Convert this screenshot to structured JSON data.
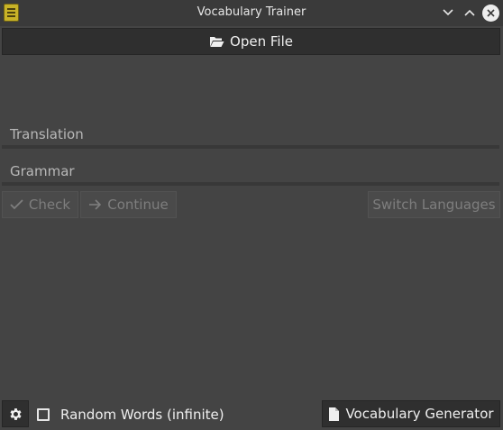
{
  "window": {
    "title": "Vocabulary Trainer",
    "icons": {
      "app": "vocabulary-app-icon",
      "minimize": "chevron-down-icon",
      "maximize": "chevron-up-icon",
      "close": "close-icon"
    }
  },
  "toolbar": {
    "open_file_label": "Open File",
    "open_file_icon": "folder-open-icon"
  },
  "fields": {
    "translation_placeholder": "Translation",
    "grammar_placeholder": "Grammar"
  },
  "actions": {
    "check_label": "Check",
    "check_icon": "checkmark-icon",
    "continue_label": "Continue",
    "continue_icon": "arrow-right-icon",
    "switch_languages_label": "Switch Languages",
    "enabled": false
  },
  "footer": {
    "settings_icon": "gear-icon",
    "random_words_label": "Random Words (infinite)",
    "random_words_checked": false,
    "vocab_generator_label": "Vocabulary Generator",
    "vocab_generator_icon": "document-icon"
  },
  "colors": {
    "background": "#444444",
    "titlebar": "#3a3a3a",
    "button": "#2f2f2f",
    "disabled_text": "#7e7e7e"
  }
}
